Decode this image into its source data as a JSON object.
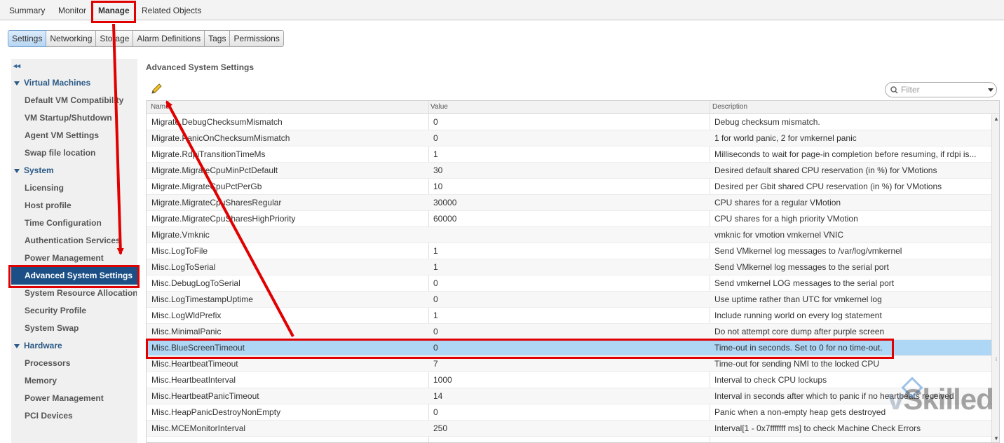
{
  "top_tabs": [
    "Summary",
    "Monitor",
    "Manage",
    "Related Objects"
  ],
  "sub_tabs": [
    "Settings",
    "Networking",
    "Storage",
    "Alarm Definitions",
    "Tags",
    "Permissions"
  ],
  "sidebar": {
    "collapse_glyph": "◂◂",
    "groups": [
      {
        "label": "Virtual Machines",
        "items": [
          "Default VM Compatibility",
          "VM Startup/Shutdown",
          "Agent VM Settings",
          "Swap file location"
        ]
      },
      {
        "label": "System",
        "items": [
          "Licensing",
          "Host profile",
          "Time Configuration",
          "Authentication Services",
          "Power Management",
          "Advanced System Settings",
          "System Resource Allocation",
          "Security Profile",
          "System Swap"
        ]
      },
      {
        "label": "Hardware",
        "items": [
          "Processors",
          "Memory",
          "Power Management",
          "PCI Devices"
        ]
      }
    ],
    "selected": "Advanced System Settings"
  },
  "main": {
    "title": "Advanced System Settings",
    "edit_icon": "pencil-icon",
    "filter_placeholder": "Filter",
    "columns": [
      "Name",
      "Value",
      "Description"
    ],
    "rows": [
      [
        "Migrate.DebugChecksumMismatch",
        "0",
        "Debug checksum mismatch."
      ],
      [
        "Migrate.PanicOnChecksumMismatch",
        "0",
        "1 for world panic, 2 for vmkernel panic"
      ],
      [
        "Migrate.RdpiTransitionTimeMs",
        "1",
        "Milliseconds to wait for page-in completion before resuming, if rdpi is..."
      ],
      [
        "Migrate.MigrateCpuMinPctDefault",
        "30",
        "Desired default shared CPU reservation (in %) for VMotions"
      ],
      [
        "Migrate.MigrateCpuPctPerGb",
        "10",
        "Desired per Gbit shared CPU reservation (in %) for VMotions"
      ],
      [
        "Migrate.MigrateCpuSharesRegular",
        "30000",
        "CPU shares for a regular VMotion"
      ],
      [
        "Migrate.MigrateCpuSharesHighPriority",
        "60000",
        "CPU shares for a high priority VMotion"
      ],
      [
        "Migrate.Vmknic",
        "",
        "vmknic for vmotion vmkernel VNIC"
      ],
      [
        "Misc.LogToFile",
        "1",
        "Send VMkernel log messages to /var/log/vmkernel"
      ],
      [
        "Misc.LogToSerial",
        "1",
        "Send VMkernel log messages to the serial port"
      ],
      [
        "Misc.DebugLogToSerial",
        "0",
        "Send vmkernel LOG messages to the serial port"
      ],
      [
        "Misc.LogTimestampUptime",
        "0",
        "Use uptime rather than UTC for vmkernel log"
      ],
      [
        "Misc.LogWldPrefix",
        "1",
        "Include running world on every log statement"
      ],
      [
        "Misc.MinimalPanic",
        "0",
        "Do not attempt core dump after purple screen"
      ],
      [
        "Misc.BlueScreenTimeout",
        "0",
        "Time-out in seconds. Set to 0 for no time-out."
      ],
      [
        "Misc.HeartbeatTimeout",
        "7",
        "Time-out for sending NMI to the locked CPU"
      ],
      [
        "Misc.HeartbeatInterval",
        "1000",
        "Interval to check CPU lockups"
      ],
      [
        "Misc.HeartbeatPanicTimeout",
        "14",
        "Interval in seconds after which to panic if no heartbeats received"
      ],
      [
        "Misc.HeapPanicDestroyNonEmpty",
        "0",
        "Panic when a non-empty heap gets destroyed"
      ],
      [
        "Misc.MCEMonitorInterval",
        "250",
        "Interval[1 - 0x7fffffff ms] to check Machine Check Errors"
      ]
    ],
    "selected_row": 14
  },
  "watermark": {
    "prefix": "v",
    "text": "Skilled"
  },
  "colors": {
    "annotation": "#e00000",
    "selection": "#aed6f5",
    "sidebar_selected": "#1b4f86"
  }
}
